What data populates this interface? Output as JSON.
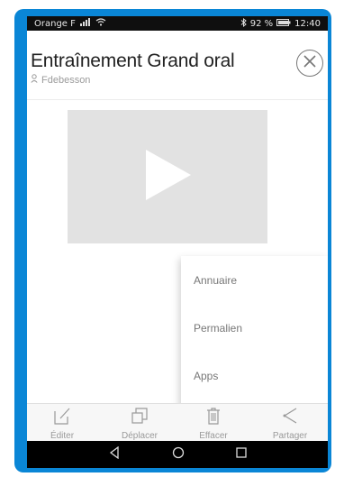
{
  "status_bar": {
    "carrier": "Orange F",
    "battery": "92 %",
    "time": "12:40"
  },
  "header": {
    "title": "Entraînement Grand oral",
    "author": "Fdebesson"
  },
  "video": {
    "icon": "play-icon"
  },
  "menu": {
    "items": [
      "Annuaire",
      "Permalien",
      "Apps"
    ]
  },
  "toolbar": {
    "items": [
      {
        "label": "Éditer",
        "icon": "edit-icon"
      },
      {
        "label": "Déplacer",
        "icon": "move-icon"
      },
      {
        "label": "Effacer",
        "icon": "trash-icon"
      },
      {
        "label": "Partager",
        "icon": "share-icon"
      }
    ]
  },
  "colors": {
    "frame": "#0a86d6",
    "status_bar": "#0f0f0f",
    "video_bg": "#e2e2e2"
  }
}
